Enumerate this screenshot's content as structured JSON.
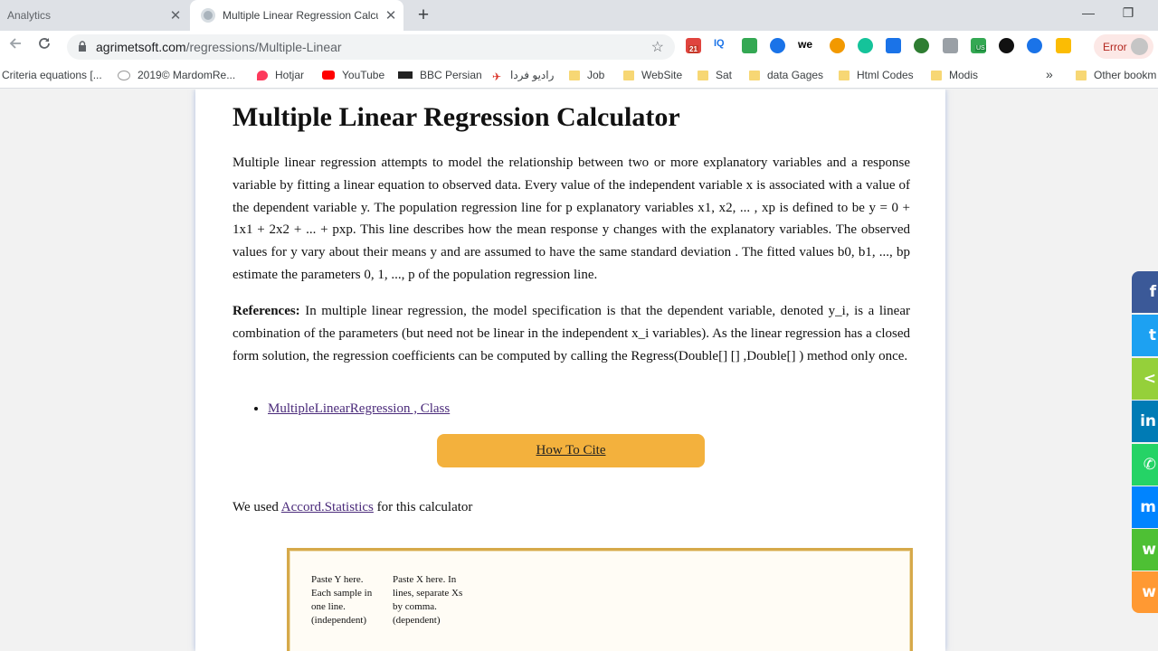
{
  "browser": {
    "tabs": [
      {
        "label": "Analytics",
        "close": "✕"
      },
      {
        "label": "Multiple Linear Regression Calcul",
        "close": "✕"
      }
    ],
    "new_tab": "+",
    "window_controls": {
      "minimize": "—",
      "restore": "❐"
    },
    "url": {
      "host": "agrimetsoft.com",
      "path": "/regressions/Multiple-Linear"
    },
    "extensions": {
      "calendar_badge": "21",
      "iq_label": "IQ",
      "we_label": "we",
      "us_badge": "US"
    },
    "error_label": "Error",
    "bookmarks": [
      {
        "label": "Criteria equations [...",
        "icon": "none"
      },
      {
        "label": "2019© MardomRe...",
        "icon": "chat-icon"
      },
      {
        "label": "Hotjar",
        "icon": "hotjar-icon"
      },
      {
        "label": "YouTube",
        "icon": "youtube-icon"
      },
      {
        "label": "BBC Persian",
        "icon": "bbc-icon"
      },
      {
        "label": "راديو فردا",
        "icon": "radio-farda-icon"
      },
      {
        "label": "Job",
        "icon": "folder-icon"
      },
      {
        "label": "WebSite",
        "icon": "folder-icon"
      },
      {
        "label": "Sat",
        "icon": "folder-icon"
      },
      {
        "label": "data Gages",
        "icon": "folder-icon"
      },
      {
        "label": "Html Codes",
        "icon": "folder-icon"
      },
      {
        "label": "Modis",
        "icon": "folder-icon"
      }
    ],
    "bookmarks_overflow": "»",
    "other_bookmarks": "Other bookm"
  },
  "page": {
    "title": "Multiple Linear Regression Calculator",
    "intro": "Multiple linear regression attempts to model the relationship between two or more explanatory variables and a response variable by fitting a linear equation to observed data. Every value of the independent variable x is associated with a value of the dependent variable y. The population regression line for p explanatory variables x1, x2, ... , xp is defined to be y = 0 + 1x1 + 2x2 + ... + pxp. This line describes how the mean response y changes with the explanatory variables. The observed values for y vary about their means y and are assumed to have the same standard deviation . The fitted values b0, b1, ..., bp estimate the parameters 0, 1, ..., p of the population regression line.",
    "references_label": "References:",
    "references_text": " In multiple linear regression, the model specification is that the dependent variable, denoted y_i, is a linear combination of the parameters (but need not be linear in the independent x_i variables). As the linear regression has a closed form solution, the regression coefficients can be computed by calling the Regress(Double[] [] ,Double[] ) method only once.",
    "ref_link": "MultipleLinearRegression , Class",
    "cite_button": "How To Cite",
    "credit_prefix": "We used ",
    "credit_link": "Accord.Statistics",
    "credit_suffix": " for this calculator",
    "hint_y": "Paste Y here. Each sample in one line. (independent)",
    "hint_x": "Paste X here. In lines, separate Xs by comma. (dependent)"
  },
  "share": [
    {
      "network": "facebook",
      "glyph": "f",
      "color": "#3b5998"
    },
    {
      "network": "twitter",
      "glyph": "t",
      "color": "#1da1f2"
    },
    {
      "network": "share",
      "glyph": "<",
      "color": "#95d03a"
    },
    {
      "network": "linkedin",
      "glyph": "in",
      "color": "#007bb5"
    },
    {
      "network": "whatsapp",
      "glyph": "✆",
      "color": "#25d366"
    },
    {
      "network": "messenger",
      "glyph": "m",
      "color": "#0084ff"
    },
    {
      "network": "wechat",
      "glyph": "w",
      "color": "#4ec034"
    },
    {
      "network": "weibo",
      "glyph": "w",
      "color": "#ff9933"
    }
  ]
}
